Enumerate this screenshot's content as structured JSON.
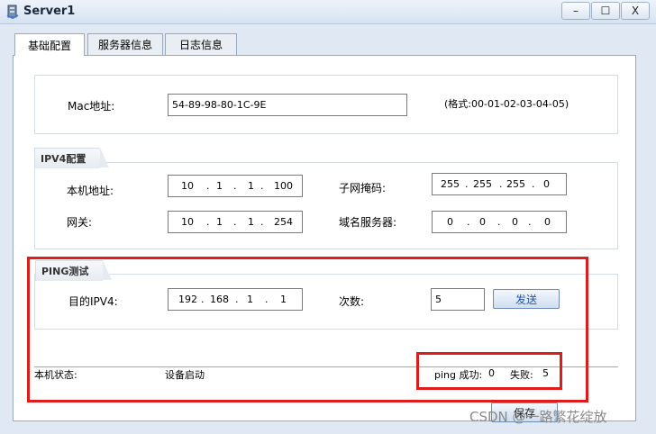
{
  "window": {
    "title": "Server1",
    "buttons": {
      "minimize": "–",
      "maximize": "☐",
      "close": "X"
    }
  },
  "tabs": [
    {
      "label": "基础配置"
    },
    {
      "label": "服务器信息"
    },
    {
      "label": "日志信息"
    }
  ],
  "mac": {
    "label": "Mac地址:",
    "value": "54-89-98-80-1C-9E",
    "format_hint": "(格式:00-01-02-03-04-05)"
  },
  "ipv4": {
    "title": "IPV4配置",
    "local_ip_label": "本机地址:",
    "local_ip": [
      "10",
      "1",
      "1",
      "100"
    ],
    "mask_label": "子网掩码:",
    "mask": [
      "255",
      "255",
      "255",
      "0"
    ],
    "gateway_label": "网关:",
    "gateway": [
      "10",
      "1",
      "1",
      "254"
    ],
    "dns_label": "域名服务器:",
    "dns": [
      "0",
      "0",
      "0",
      "0"
    ]
  },
  "ping": {
    "title": "PING测试",
    "target_label": "目的IPV4:",
    "target": [
      "192",
      "168",
      "1",
      "1"
    ],
    "count_label": "次数:",
    "count": "5",
    "send_label": "发送"
  },
  "status": {
    "label": "本机状态:",
    "value": "设备启动",
    "success_label": "ping 成功:",
    "success_value": "0",
    "fail_label": "失败:",
    "fail_value": "5"
  },
  "footer": {
    "save_label": "保存",
    "watermark": "CSDN @一路繁花绽放"
  },
  "colors": {
    "highlight": "#e01b1b",
    "send_text": "#1f57a8"
  }
}
